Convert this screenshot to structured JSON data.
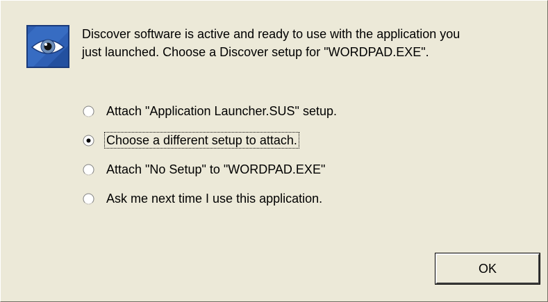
{
  "dialog": {
    "icon": "discover-eye-icon",
    "message_line1": "Discover software is active and ready to use with the application you",
    "message_line2": "just launched.  Choose a Discover setup for \"WORDPAD.EXE\"."
  },
  "options": [
    {
      "label": "Attach \"Application Launcher.SUS\" setup.",
      "selected": false
    },
    {
      "label": "Choose a different setup to attach.",
      "selected": true
    },
    {
      "label": "Attach \"No Setup\" to \"WORDPAD.EXE\"",
      "selected": false
    },
    {
      "label": "Ask me next time I use this application.",
      "selected": false
    }
  ],
  "buttons": {
    "ok_label": "OK"
  },
  "colors": {
    "background": "#ece9d8",
    "icon_blue": "#2e5fb4"
  }
}
